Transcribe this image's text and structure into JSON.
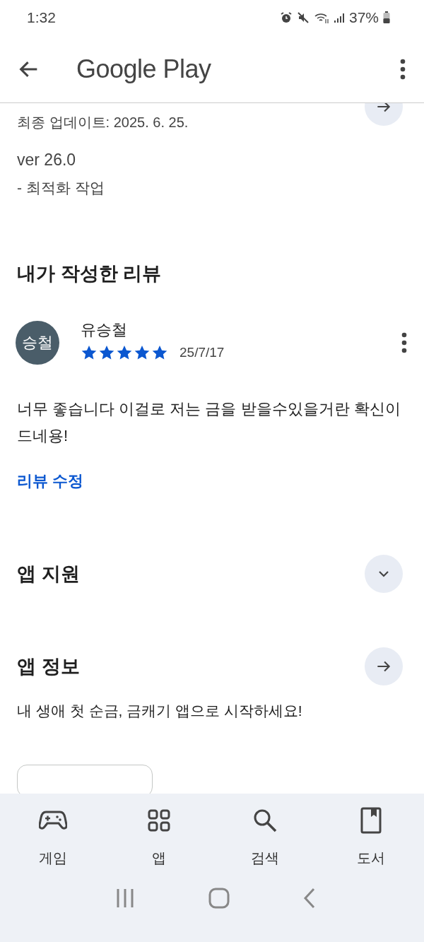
{
  "status_bar": {
    "time": "1:32",
    "battery": "37%"
  },
  "app_bar": {
    "title": "Google Play"
  },
  "update": {
    "last_updated": "최종 업데이트: 2025. 6. 25.",
    "version": "ver 26.0",
    "notes": "- 최적화 작업"
  },
  "my_review": {
    "heading": "내가 작성한 리뷰",
    "avatar": "승철",
    "author": "유승철",
    "stars": 5,
    "date": "25/7/17",
    "text": "너무 좋습니다 이걸로 저는 금을 받을수있을거란 확신이 드네용!",
    "edit_link": "리뷰 수정"
  },
  "sections": [
    {
      "title": "앱 지원",
      "kind": "expand"
    },
    {
      "title": "앱 정보",
      "kind": "arrow",
      "description": "내 생애 첫 순금, 금캐기 앱으로 시작하세요!"
    }
  ],
  "bottom_nav": [
    {
      "label": "게임",
      "kind": "games"
    },
    {
      "label": "앱",
      "kind": "apps"
    },
    {
      "label": "검색",
      "kind": "search"
    },
    {
      "label": "도서",
      "kind": "books"
    }
  ]
}
